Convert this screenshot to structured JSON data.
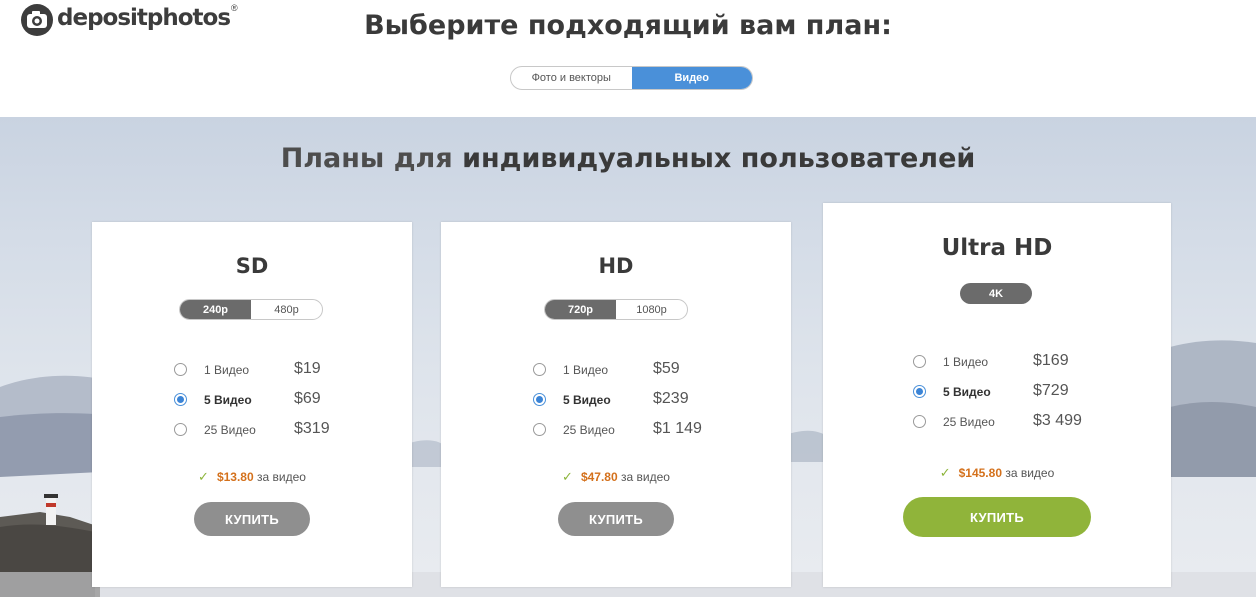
{
  "header": {
    "logo_text": "depositphotos",
    "logo_reg": "®",
    "title": "Выберите подходящий вам план:",
    "type_toggle": [
      {
        "label": "Фото и векторы",
        "active": false
      },
      {
        "label": "Видео",
        "active": true
      }
    ]
  },
  "section": {
    "title_light": "Планы для ",
    "title_bold": "индивидуальных пользователей"
  },
  "plans": [
    {
      "name": "SD",
      "resolutions": [
        {
          "label": "240p",
          "active": true
        },
        {
          "label": "480p",
          "active": false
        }
      ],
      "options": [
        {
          "label": "1 Видео",
          "price": "$19",
          "selected": false
        },
        {
          "label": "5 Видео",
          "price": "$69",
          "selected": true
        },
        {
          "label": "25 Видео",
          "price": "$319",
          "selected": false
        }
      ],
      "per_item_value": "$13.80",
      "per_item_suffix": "за видео",
      "buy_label": "КУПИТЬ"
    },
    {
      "name": "HD",
      "resolutions": [
        {
          "label": "720p",
          "active": true
        },
        {
          "label": "1080p",
          "active": false
        }
      ],
      "options": [
        {
          "label": "1 Видео",
          "price": "$59",
          "selected": false
        },
        {
          "label": "5 Видео",
          "price": "$239",
          "selected": true
        },
        {
          "label": "25 Видео",
          "price": "$1 149",
          "selected": false
        }
      ],
      "per_item_value": "$47.80",
      "per_item_suffix": "за видео",
      "buy_label": "КУПИТЬ"
    },
    {
      "name": "Ultra HD",
      "resolutions": [
        {
          "label": "4K",
          "active": true
        }
      ],
      "options": [
        {
          "label": "1 Видео",
          "price": "$169",
          "selected": false
        },
        {
          "label": "5 Видео",
          "price": "$729",
          "selected": true
        },
        {
          "label": "25 Видео",
          "price": "$3 499",
          "selected": false
        }
      ],
      "per_item_value": "$145.80",
      "per_item_suffix": "за видео",
      "buy_label": "КУПИТЬ"
    }
  ],
  "colors": {
    "accent_blue": "#4a90d9",
    "price_orange": "#d4711c",
    "buy_green": "#90b43a",
    "buy_gray": "#8f8f8f"
  }
}
